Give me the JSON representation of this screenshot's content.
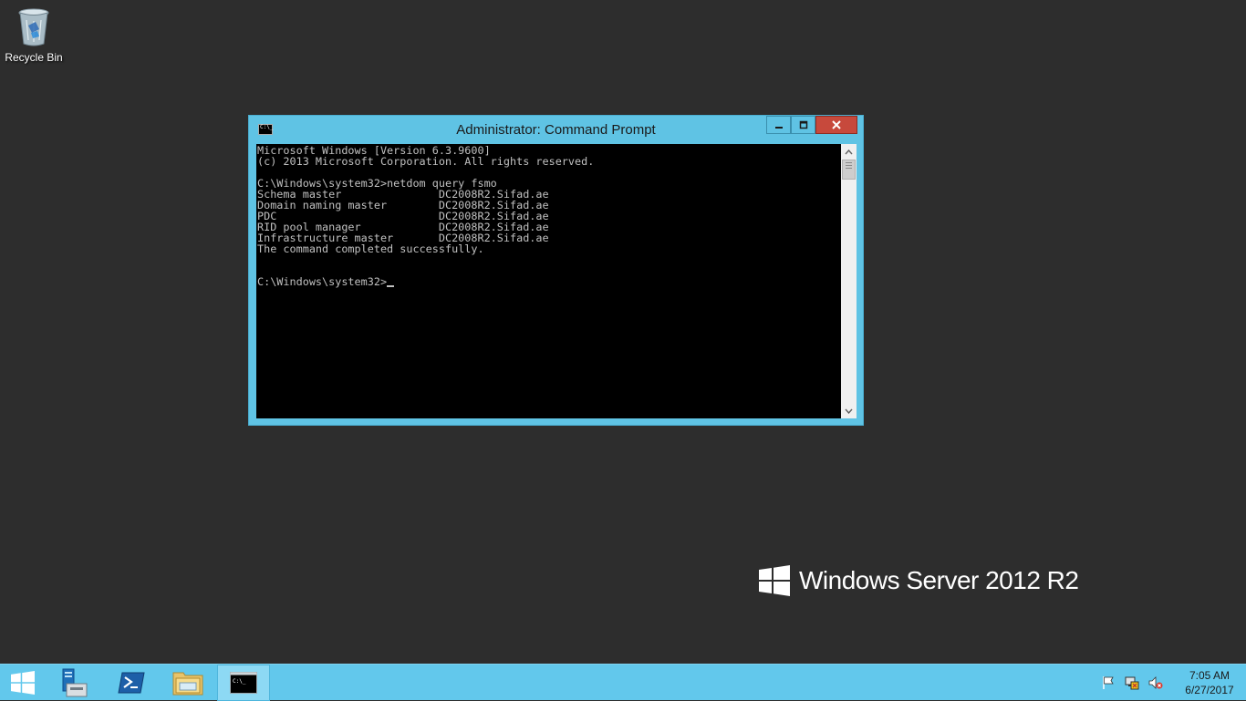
{
  "desktop": {
    "icons": [
      {
        "label": "Recycle Bin",
        "icon": "recycle-bin-icon"
      }
    ],
    "branding": "Windows Server 2012 R2"
  },
  "window": {
    "title": "Administrator: Command Prompt",
    "app_icon_text": "C:\\_",
    "min_label": "–",
    "max_label": "□",
    "close_label": "✕",
    "console_lines": [
      "Microsoft Windows [Version 6.3.9600]",
      "(c) 2013 Microsoft Corporation. All rights reserved.",
      "",
      "C:\\Windows\\system32>netdom query fsmo",
      "Schema master               DC2008R2.Sifad.ae",
      "Domain naming master        DC2008R2.Sifad.ae",
      "PDC                         DC2008R2.Sifad.ae",
      "RID pool manager            DC2008R2.Sifad.ae",
      "Infrastructure master       DC2008R2.Sifad.ae",
      "The command completed successfully.",
      "",
      "",
      "C:\\Windows\\system32>"
    ]
  },
  "taskbar": {
    "buttons": [
      {
        "name": "start",
        "icon": "windows-logo-icon"
      },
      {
        "name": "server-manager",
        "icon": "server-manager-icon"
      },
      {
        "name": "powershell",
        "icon": "powershell-icon"
      },
      {
        "name": "file-explorer",
        "icon": "folder-icon"
      },
      {
        "name": "command-prompt",
        "icon": "cmd-icon",
        "active": true
      }
    ],
    "tray_icons": [
      "flag-icon",
      "network-icon",
      "speaker-muted-icon"
    ],
    "clock": {
      "time": "7:05 AM",
      "date": "6/27/2017"
    }
  },
  "colors": {
    "accent": "#5fc3e4",
    "taskbar": "#62c8ec",
    "desktop": "#2d2d2d",
    "close": "#c7493c",
    "console_bg": "#000000",
    "console_fg": "#c0c0c0"
  }
}
